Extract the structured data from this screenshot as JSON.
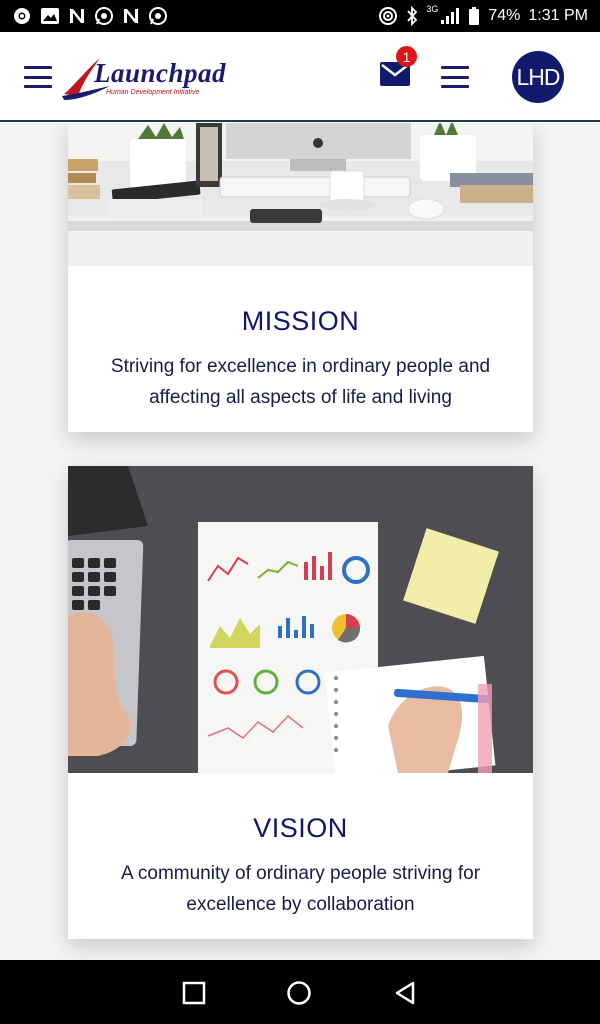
{
  "status_bar": {
    "network_type": "3G",
    "battery": "74%",
    "time": "1:31 PM",
    "left_icons": [
      "chrome-icon",
      "gallery-icon",
      "n-app-icon",
      "whatsapp-icon",
      "n-app-icon",
      "whatsapp-icon"
    ],
    "right_icons": [
      "hotspot-icon",
      "bluetooth-icon",
      "signal-icon",
      "battery-icon"
    ]
  },
  "header": {
    "logo_text": "Launchpad",
    "logo_tagline": "Human Development Initiative",
    "mail_badge_count": "1",
    "avatar_initials": "LHD",
    "colors": {
      "brand": "#1a1a6e",
      "accent": "#c0141e",
      "badge": "#e0121a"
    }
  },
  "cards": [
    {
      "title": "MISSION",
      "body": "Striving for excellence in ordinary people and affecting all aspects of life and living",
      "image": "desk-with-computer-photo"
    },
    {
      "title": "VISION",
      "body": "A community of ordinary people striving for excellence by collaboration",
      "image": "charts-and-laptop-photo"
    }
  ],
  "nav_bar": {
    "buttons": [
      "recent-apps-icon",
      "home-icon",
      "back-icon"
    ]
  }
}
